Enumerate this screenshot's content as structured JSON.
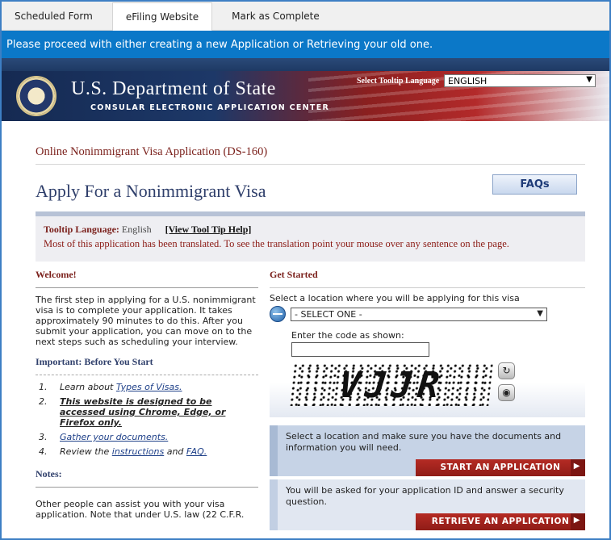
{
  "tabs": [
    {
      "label": "Scheduled Form"
    },
    {
      "label": "eFiling Website"
    },
    {
      "label": "Mark as Complete"
    }
  ],
  "banner_message": "Please proceed with either creating a new Application or Retrieving your old one.",
  "header": {
    "department": "U.S. Department of State",
    "subtitle": "CONSULAR ELECTRONIC APPLICATION CENTER",
    "tooltip_language_label": "Select Tooltip Language",
    "tooltip_language_value": "ENGLISH"
  },
  "page": {
    "form_title": "Online Nonimmigrant Visa Application (DS-160)",
    "title": "Apply For a Nonimmigrant Visa",
    "faq_label": "FAQs"
  },
  "tooltip_box": {
    "label": "Tooltip Language:",
    "language": "English",
    "help_link": "[View Tool Tip Help]",
    "message": "Most of this application has been translated. To see the translation point your mouse over any sentence on the page."
  },
  "left": {
    "welcome_heading": "Welcome!",
    "welcome_text": "The first step in applying for a U.S. nonimmigrant visa is to complete your application. It takes approximately 90 minutes to do this. After you submit your application, you can move on to the next steps such as scheduling your interview.",
    "important_heading": "Important: Before You Start",
    "steps": [
      {
        "num": "1.",
        "pre": "Learn about ",
        "link": "Types of Visas."
      },
      {
        "num": "2.",
        "bold": "This website is designed to be accessed using Chrome, Edge, or Firefox only."
      },
      {
        "num": "3.",
        "link": "Gather your documents."
      },
      {
        "num": "4.",
        "pre": "Review the ",
        "link": "instructions",
        "mid": " and ",
        "link2": "FAQ."
      }
    ],
    "notes_heading": "Notes:",
    "notes_text": "Other people can assist you with your visa application. Note that under U.S. law (22 C.F.R."
  },
  "right": {
    "heading": "Get Started",
    "location_label": "Select a location where you will be applying for this visa",
    "location_value": "- SELECT ONE -",
    "code_label": "Enter the code as shown:",
    "code_value": "",
    "captcha_text": "VJJR",
    "refresh_icon": "refresh-icon",
    "audio_icon": "audio-icon",
    "start_text": "Select a location and make sure you have the documents and information you will need.",
    "start_button": "START AN APPLICATION",
    "retrieve_text": "You will be asked for your application ID and answer a security question.",
    "retrieve_button": "RETRIEVE AN APPLICATION"
  },
  "colors": {
    "accent_blue": "#0b78c8",
    "maroon": "#7a1f1a",
    "button_red": "#b52b24"
  }
}
